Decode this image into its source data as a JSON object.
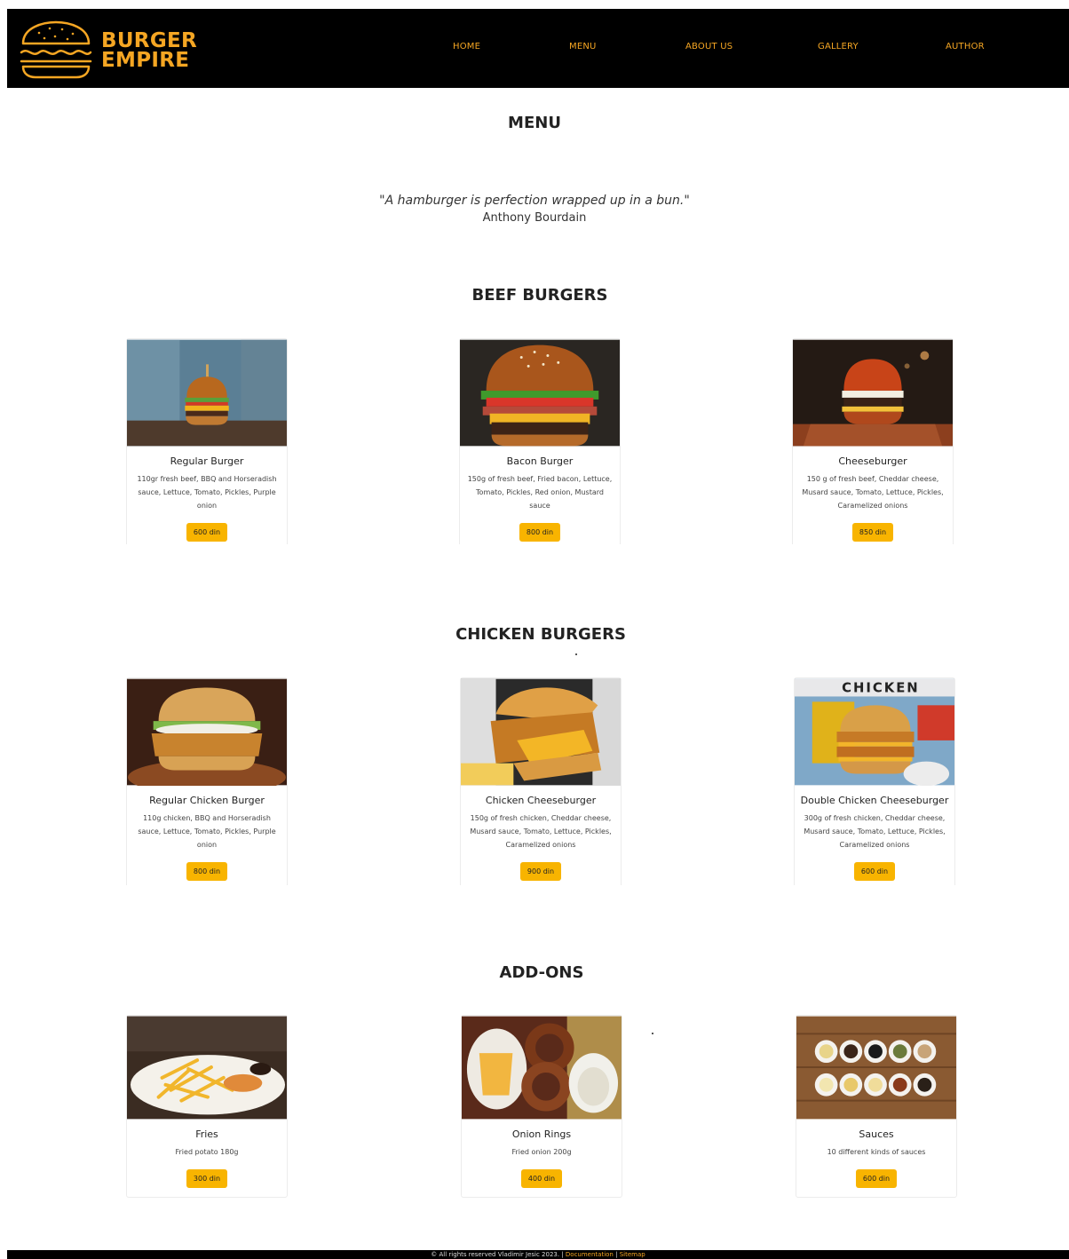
{
  "brand": {
    "line1": "BURGER",
    "line2": "EMPIRE",
    "color": "#f5a623"
  },
  "nav": {
    "items": [
      {
        "label": "HOME"
      },
      {
        "label": "MENU"
      },
      {
        "label": "ABOUT US"
      },
      {
        "label": "GALLERY"
      },
      {
        "label": "AUTHOR"
      }
    ]
  },
  "page": {
    "title": "MENU",
    "quote": "\"A hamburger is perfection wrapped up in a bun.\"",
    "quote_author": "Anthony Bourdain"
  },
  "sections": [
    {
      "title": "BEEF BURGERS",
      "items": [
        {
          "name": "Regular Burger",
          "desc": "110gr fresh beef, BBQ and Horseradish sauce, Lettuce, Tomato, Pickles, Purple onion",
          "price": "600 din",
          "image": "burger-photo"
        },
        {
          "name": "Bacon Burger",
          "desc": "150g of fresh beef, Fried bacon, Lettuce, Tomato, Pickles, Red onion, Mustard sauce",
          "price": "800 din",
          "image": "burger-photo"
        },
        {
          "name": "Cheeseburger",
          "desc": "150 g of fresh beef, Cheddar cheese, Musard sauce, Tomato, Lettuce, Pickles, Caramelized onions",
          "price": "850 din",
          "image": "burger-photo"
        }
      ]
    },
    {
      "title": "CHICKEN BURGERS",
      "items": [
        {
          "name": "Regular Chicken Burger",
          "desc": "110g chicken, BBQ and Horseradish sauce, Lettuce, Tomato, Pickles, Purple onion",
          "price": "800 din",
          "image": "chicken-burger-photo"
        },
        {
          "name": "Chicken Cheeseburger",
          "desc": "150g of fresh chicken, Cheddar cheese, Musard sauce, Tomato, Lettuce, Pickles, Caramelized onions",
          "price": "900 din",
          "image": "chicken-burger-photo"
        },
        {
          "name": "Double Chicken Cheeseburger",
          "desc": "300g of fresh chicken, Cheddar cheese, Musard sauce, Tomato, Lettuce, Pickles, Caramelized onions",
          "price": "600 din",
          "image": "chicken-burger-photo",
          "sign_text": "CHICKEN"
        }
      ]
    },
    {
      "title": "ADD-ONS",
      "items": [
        {
          "name": "Fries",
          "desc": "Fried potato 180g",
          "price": "300 din",
          "image": "fries-photo"
        },
        {
          "name": "Onion Rings",
          "desc": "Fried onion 200g",
          "price": "400 din",
          "image": "onion-rings-photo"
        },
        {
          "name": "Sauces",
          "desc": "10 different kinds of sauces",
          "price": "600 din",
          "image": "sauces-photo"
        }
      ]
    }
  ],
  "footer": {
    "text": "© All rights reserved Vladimir Jesic 2023. |",
    "links": [
      {
        "label": "Documentation"
      },
      {
        "label": "Sitemap"
      }
    ],
    "separator": "|"
  },
  "colors": {
    "accent": "#f8b400",
    "nav_bg": "#000000"
  }
}
